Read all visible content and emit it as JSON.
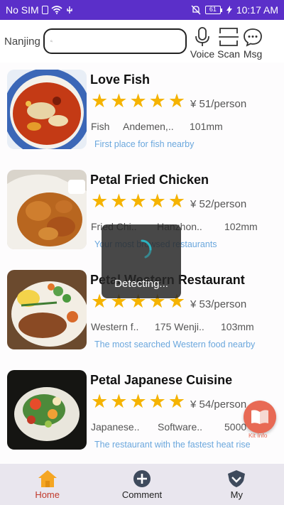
{
  "status_bar": {
    "carrier": "No SIM",
    "battery": "61",
    "time": "10:17 AM"
  },
  "header": {
    "city": "Nanjing",
    "search_placeholder": "",
    "actions": [
      {
        "label": "Voice",
        "icon": "microphone-icon"
      },
      {
        "label": "Scan",
        "icon": "scan-icon"
      },
      {
        "label": "Msg",
        "icon": "message-icon"
      }
    ]
  },
  "restaurants": [
    {
      "name": "Love Fish",
      "rating": 5,
      "price": "¥ 51/person",
      "category": "Fish",
      "area": "Andemen,..",
      "distance": "101mm",
      "tag": "First place for fish nearby",
      "image": "fish-dish"
    },
    {
      "name": "Petal Fried Chicken",
      "rating": 5,
      "price": "¥ 52/person",
      "category": "Fried Chi..",
      "area": "Hanzhon..",
      "distance": "102mm",
      "tag": "Your most browsed restaurants",
      "image": "fried-chicken"
    },
    {
      "name": "Petal Western Restaurant",
      "rating": 5,
      "price": "¥ 53/person",
      "category": "Western f..",
      "area": "175 Wenji..",
      "distance": "103mm",
      "tag": "The most searched Western food nearby",
      "image": "western-dish"
    },
    {
      "name": "Petal Japanese Cuisine",
      "rating": 5,
      "price": "¥ 54/person",
      "category": "Japanese..",
      "area": "Software..",
      "distance": "5000",
      "tag": "The restaurant with the fastest heat rise",
      "image": "japanese-dish"
    }
  ],
  "loading": {
    "text": "Detecting..."
  },
  "fab": {
    "label": "Kit Info",
    "icon": "book-icon"
  },
  "bottom_nav": [
    {
      "label": "Home",
      "icon": "home-icon",
      "active": true
    },
    {
      "label": "Comment",
      "icon": "plus-circle-icon",
      "active": false
    },
    {
      "label": "My",
      "icon": "user-shield-icon",
      "active": false
    }
  ],
  "colors": {
    "status_bar": "#5b2fc9",
    "star": "#f5b301",
    "tag": "#6aa7dd",
    "active_nav": "#c0392b",
    "home_icon": "#f5a623",
    "fab": "#e86a55"
  }
}
